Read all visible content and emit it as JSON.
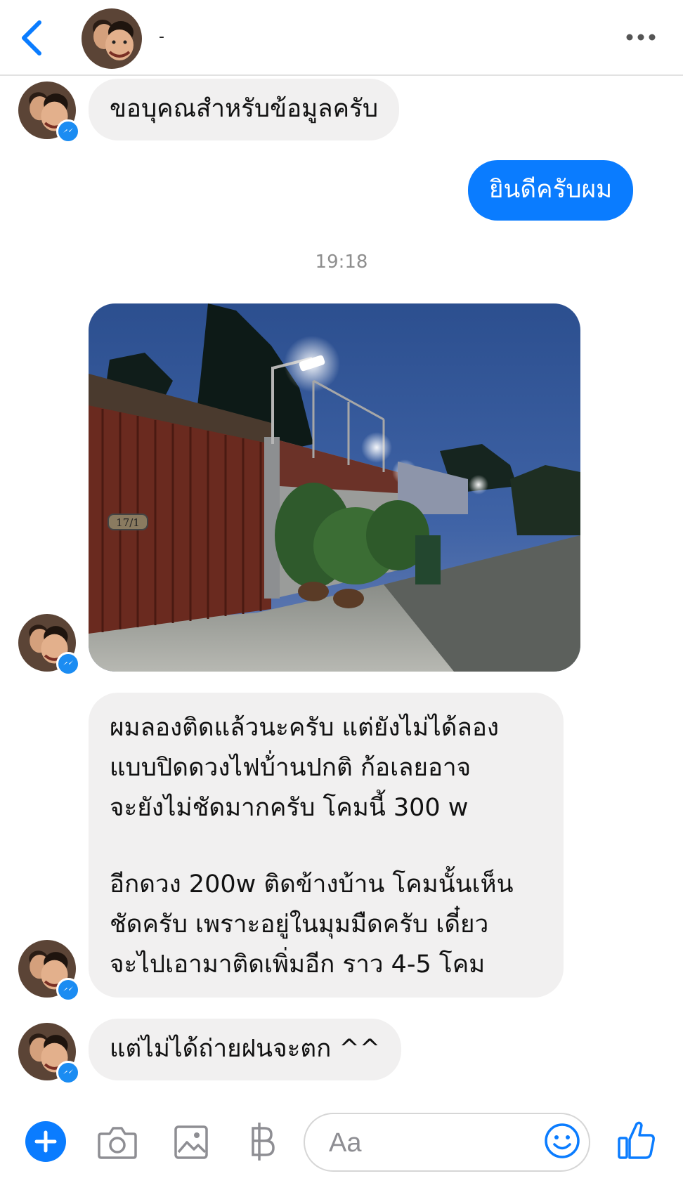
{
  "header": {
    "contact_name": "-",
    "back_icon": "chevron-left-icon",
    "more_icon": "ellipsis-icon"
  },
  "messages": [
    {
      "direction": "in",
      "text": "ขอบุคณสำหรับข้อมูลครับ"
    },
    {
      "direction": "out",
      "text": "ยินดีครับผม"
    },
    {
      "direction": "in",
      "type": "photo",
      "house_number": "17/1"
    },
    {
      "direction": "in",
      "lines": [
        "ผมลองติดแล้วนะครับ แต่ยังไม่ได้ลอง",
        "แบบปิดดวงไฟบ้่านปกติ ก้อเลยอาจ",
        "จะยังไม่ชัดมากครับ โคมนี้ 300 w",
        "อีกดวง 200w ติดข้างบ้าน โคมนั้นเห็น",
        "ชัดครับ เพราะอยู่ในมุมมืดครับ เดี๋ยว",
        "จะไปเอามาติดเพิ่มอีก ราว 4-5 โคม"
      ]
    },
    {
      "direction": "in",
      "text": "แต่ไม่ได้ถ่ายฝนจะตก ^^"
    }
  ],
  "timestamp": "19:18",
  "composer": {
    "placeholder": "Aa",
    "value": "",
    "buttons": [
      "plus-icon",
      "camera-icon",
      "image-icon",
      "baht-icon",
      "emoji-icon",
      "thumbs-up-icon"
    ]
  },
  "colors": {
    "accent": "#0a7cff",
    "incoming_bubble": "#f1f0f0",
    "badge": "#1b8cf2",
    "timestamp": "#8e8e8e"
  }
}
